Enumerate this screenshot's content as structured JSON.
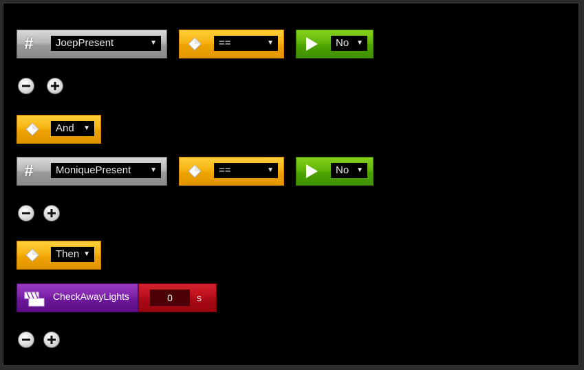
{
  "rows": [
    {
      "variable": "JoepPresent",
      "operator": "==",
      "value": "No"
    },
    {
      "variable": "MoniquePresent",
      "operator": "==",
      "value": "No"
    }
  ],
  "connector": {
    "label": "And"
  },
  "then": {
    "label": "Then"
  },
  "action": {
    "name": "CheckAwayLights",
    "delay_value": "0",
    "delay_unit": "s"
  },
  "icons": {
    "variable": "hash-icon",
    "operator": "diamond-icon",
    "value": "play-icon",
    "action": "scene-clapper-icon",
    "remove": "minus-circle-icon",
    "add": "plus-circle-icon"
  },
  "colors": {
    "variable_block": "#a8a8a8",
    "operator_block": "#f2ab08",
    "value_block": "#5aae06",
    "action_block": "#7c22a8",
    "delay_block": "#bb101c",
    "background": "#000000"
  }
}
